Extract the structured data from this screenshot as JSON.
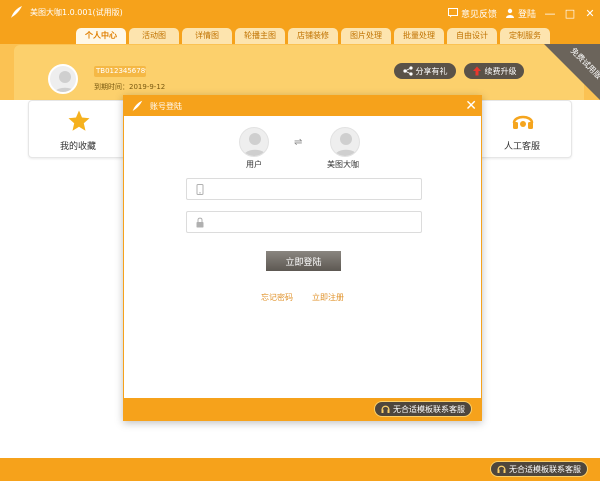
{
  "window": {
    "title": "美图大咖1.0.001(试用版)",
    "feedback": "意见反馈",
    "login": "登陆",
    "minimize": "—",
    "maximize": "□",
    "close": "✕"
  },
  "tabs": [
    {
      "label": "个人中心",
      "active": true
    },
    {
      "label": "活动图"
    },
    {
      "label": "详情图"
    },
    {
      "label": "轮播主图"
    },
    {
      "label": "店铺装修"
    },
    {
      "label": "图片处理"
    },
    {
      "label": "批量处理"
    },
    {
      "label": "自由设计"
    },
    {
      "label": "定制服务"
    }
  ],
  "profile": {
    "user_id": "TB01234567890",
    "expire": "到期时间：2019-9-12",
    "share_button": "分享有礼",
    "renew_button": "续费升级",
    "corner_badge": "免费试用版"
  },
  "cards": {
    "favorites": "我的收藏",
    "support": "人工客服"
  },
  "dialog": {
    "title": "账号登陆",
    "close": "✕",
    "user_label": "用户",
    "admin_label": "美图大咖",
    "swap": "⇌",
    "phone_placeholder": "",
    "password_placeholder": "",
    "login_button": "立即登陆",
    "forgot": "忘记密码",
    "register": "立即注册",
    "service_button": "无合适模板联系客服"
  },
  "footer": {
    "service_button": "无合适模板联系客服"
  },
  "colors": {
    "brand_orange": "#f6a21b",
    "header_yellow": "#fbc253",
    "dark_button": "#5a5248",
    "link": "#e0922a"
  }
}
